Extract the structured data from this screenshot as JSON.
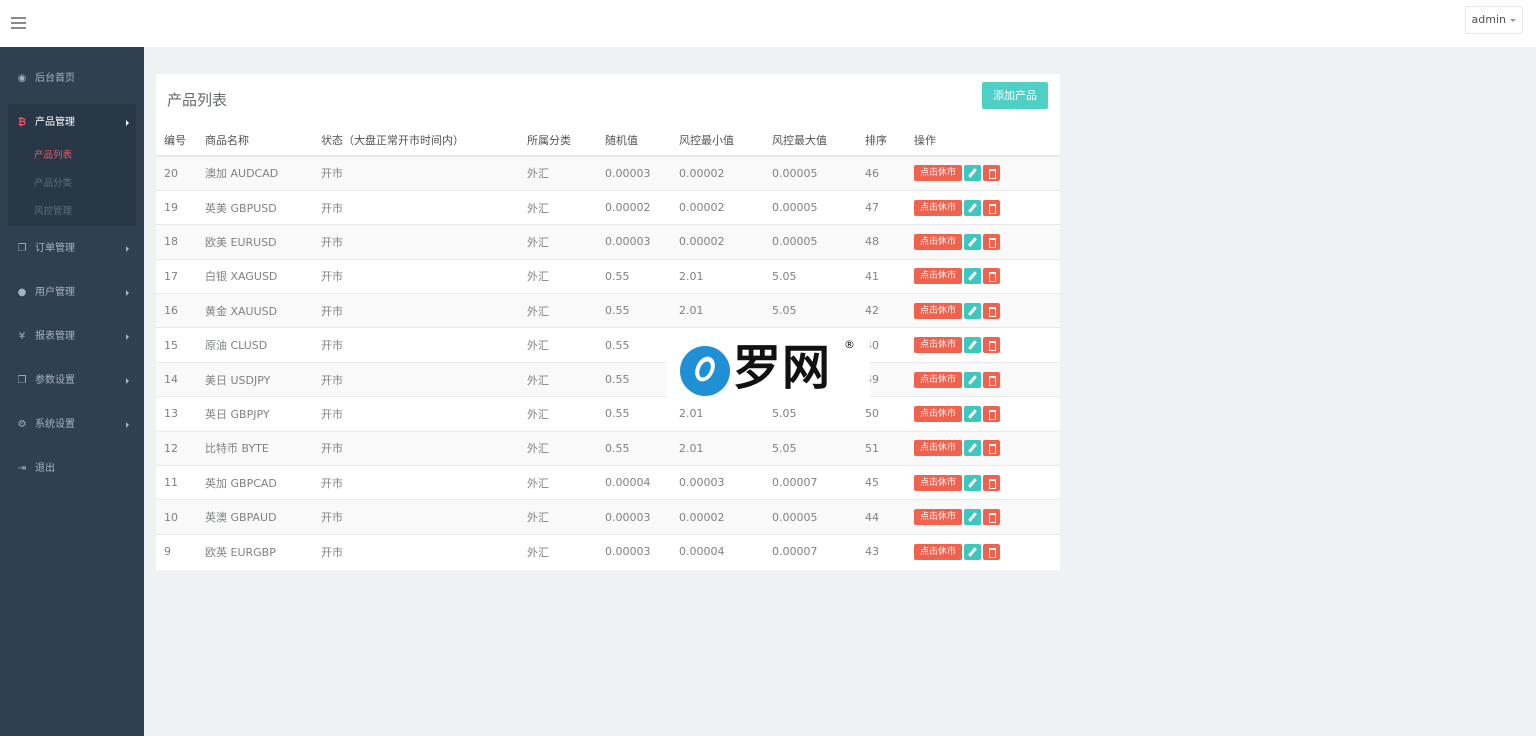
{
  "header": {
    "user": "admin"
  },
  "sidebar": {
    "items": [
      {
        "label": "后台首页",
        "icon": "dashboard-icon"
      },
      {
        "label": "产品管理",
        "icon": "bitcoin-icon"
      },
      {
        "label": "订单管理",
        "icon": "copy-icon"
      },
      {
        "label": "用户管理",
        "icon": "user-icon"
      },
      {
        "label": "报表管理",
        "icon": "yen-icon"
      },
      {
        "label": "参数设置",
        "icon": "copy-icon"
      },
      {
        "label": "系统设置",
        "icon": "gears-icon"
      },
      {
        "label": "退出",
        "icon": "sign-out-icon"
      }
    ],
    "subitems": [
      "产品列表",
      "产品分类",
      "风控管理"
    ]
  },
  "panel": {
    "title": "产品列表",
    "add_button": "添加产品"
  },
  "table": {
    "headers": [
      "编号",
      "商品名称",
      "状态（大盘正常开市时间内）",
      "所属分类",
      "随机值",
      "风控最小值",
      "风控最大值",
      "排序",
      "操作"
    ],
    "rows": [
      [
        "20",
        "澳加 AUDCAD",
        "开市",
        "外汇",
        "0.00003",
        "0.00002",
        "0.00005",
        "46"
      ],
      [
        "19",
        "英美 GBPUSD",
        "开市",
        "外汇",
        "0.00002",
        "0.00002",
        "0.00005",
        "47"
      ],
      [
        "18",
        "欧美 EURUSD",
        "开市",
        "外汇",
        "0.00003",
        "0.00002",
        "0.00005",
        "48"
      ],
      [
        "17",
        "白银 XAGUSD",
        "开市",
        "外汇",
        "0.55",
        "2.01",
        "5.05",
        "41"
      ],
      [
        "16",
        "黄金 XAUUSD",
        "开市",
        "外汇",
        "0.55",
        "2.01",
        "5.05",
        "42"
      ],
      [
        "15",
        "原油 CLUSD",
        "开市",
        "外汇",
        "0.55",
        "",
        "",
        "40"
      ],
      [
        "14",
        "美日 USDJPY",
        "开市",
        "外汇",
        "0.55",
        "",
        "",
        "49"
      ],
      [
        "13",
        "英日 GBPJPY",
        "开市",
        "外汇",
        "0.55",
        "2.01",
        "5.05",
        "50"
      ],
      [
        "12",
        "比特币 BYTE",
        "开市",
        "外汇",
        "0.55",
        "2.01",
        "5.05",
        "51"
      ],
      [
        "11",
        "英加 GBPCAD",
        "开市",
        "外汇",
        "0.00004",
        "0.00003",
        "0.00007",
        "45"
      ],
      [
        "10",
        "英澳 GBPAUD",
        "开市",
        "外汇",
        "0.00003",
        "0.00002",
        "0.00005",
        "44"
      ],
      [
        "9",
        "欧英 EURGBP",
        "开市",
        "外汇",
        "0.00003",
        "0.00004",
        "0.00007",
        "43"
      ]
    ],
    "row_action_label": "点击休市"
  },
  "watermark": {
    "text": "罗网",
    "mark": "®"
  }
}
